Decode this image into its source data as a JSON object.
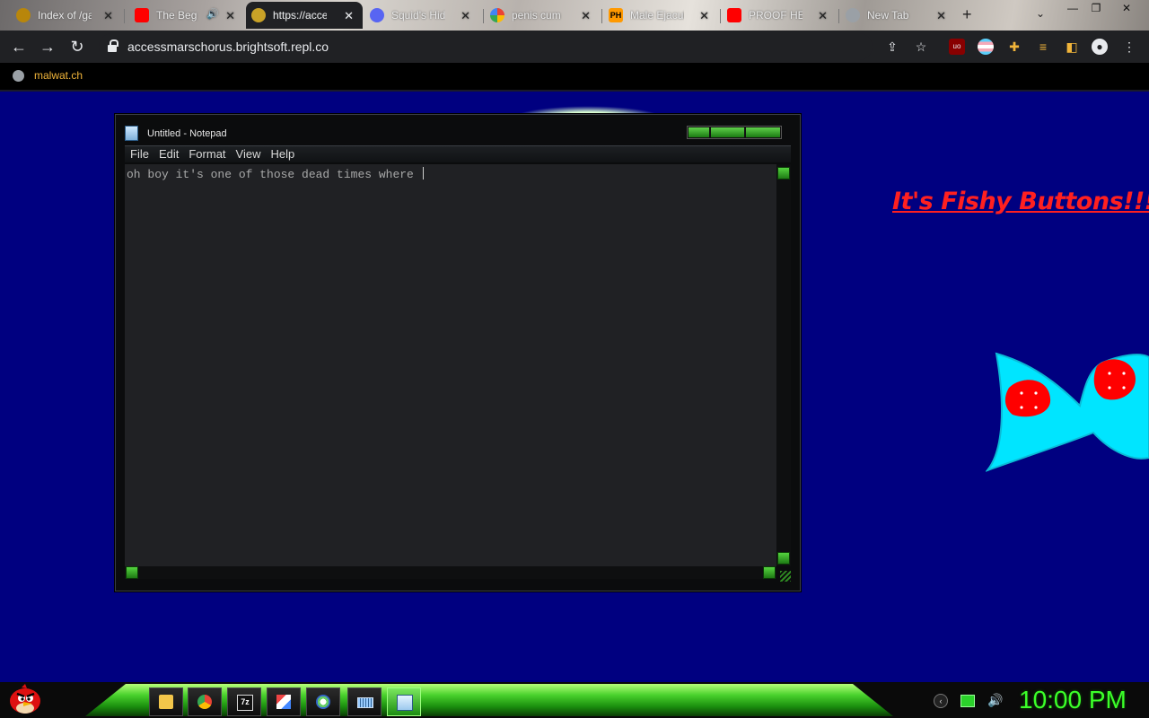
{
  "browser": {
    "tabs": [
      {
        "title": "Index of /ga",
        "favicon_color": "#b8860b"
      },
      {
        "title": "The Beg",
        "favicon_color": "#ff0000",
        "audio": "🔊"
      },
      {
        "title": "https://acce",
        "favicon_color": "#c9a227",
        "active": true
      },
      {
        "title": "Squid's Hid",
        "favicon_color": "#5865f2"
      },
      {
        "title": "penis cum",
        "favicon_color": "#4285f4"
      },
      {
        "title": "Male Ejacul",
        "favicon_color": "#ff9900",
        "favicon_text": "PH"
      },
      {
        "title": "PROOF HE",
        "favicon_color": "#ff0000"
      },
      {
        "title": "New Tab",
        "favicon_color": "#9aa0a6"
      }
    ],
    "close_glyph": "✕",
    "new_tab_glyph": "+",
    "tab_search_glyph": "⌄",
    "window_controls": {
      "minimize": "—",
      "restore": "❐",
      "close": "✕"
    },
    "nav": {
      "back": "←",
      "forward": "→",
      "reload": "↻"
    },
    "url": "accessmarschorus.brightsoft.repl.co",
    "toolbar_icons": [
      "share-icon",
      "star-icon",
      "ublock-icon",
      "flag-icon",
      "puzzle-icon",
      "media-icon",
      "sidepanel-icon",
      "profile-icon",
      "menu-icon"
    ],
    "bookmark": "malwat.ch"
  },
  "notepad": {
    "title": "Untitled - Notepad",
    "menu": [
      "File",
      "Edit",
      "Format",
      "View",
      "Help"
    ],
    "text": "oh boy it's one of those dead times where "
  },
  "page": {
    "heading": "It's Fishy Buttons!!!"
  },
  "taskbar": {
    "apps": [
      "folder-icon",
      "chrome-icon",
      "7zip-icon",
      "paint-icon",
      "paintbrush-icon",
      "keyboard-icon",
      "notepad-icon"
    ],
    "clock": "10:00 PM"
  },
  "colors": {
    "desktop_bg": "#000080",
    "accent_green": "#3cff2a",
    "heading_red": "#ff2020",
    "fish_cyan": "#00e5ff"
  }
}
